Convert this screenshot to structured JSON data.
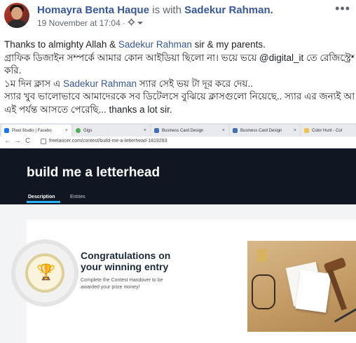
{
  "post": {
    "author": "Homayra Benta Haque",
    "with_text": " is with ",
    "tagged": "Sadekur Rahman.",
    "date": "19 November at 17:04",
    "separator": "·",
    "privacy_icon": "gear-icon",
    "more_label": "•••",
    "body": {
      "line1_a": "Thanks to almighty Allah & ",
      "line1_mention": "Sadekur Rahman",
      "line1_b": " sir & my parents.",
      "line2": "গ্রাফিক ডিজাইন সম্পর্কে আমার কোন আইডিয়া ছিলো না। ভয়ে ভয়ে @digital_it তে রেজিস্ট্রেশন",
      "line3": "করি.",
      "line4_a": "১ম দিন ক্লাস এ ",
      "line4_mention": "Sadekur Rahman",
      "line4_b": " স্যার সেই ভয় টা দূর করে দেয়..",
      "line5": "স্যার খুব ভালোভাবে আমাদেরকে সব ডিটেলসে বুঝিয়ে ক্লাসগুলো নিয়েছে.. স্যার এর জন্যই আমি",
      "line6": "এই পর্যন্ত আসতে পেরেছি... thanks a lot sir."
    }
  },
  "screenshot": {
    "tabs": [
      {
        "label": "Pixel Studio | Facebo",
        "color": "#1877f2"
      },
      {
        "label": "Gigs",
        "color": "#4caf50"
      },
      {
        "label": "Business Card Design",
        "color": "#3f6fb5"
      },
      {
        "label": "Business Card Design",
        "color": "#3f6fb5"
      },
      {
        "label": "Color Hunt - Col",
        "color": "#f2c14e"
      }
    ],
    "tab_close": "×",
    "url": "freelancer.com/contest/build-me-a-letterhead-1819283",
    "nav": {
      "back": "←",
      "forward": "→",
      "reload": "C"
    },
    "page_title": "build me a letterhead",
    "page_tabs": [
      "Description",
      "Entries"
    ],
    "congrats_title": "Congratulations on your winning entry",
    "congrats_sub": "Complete the Contest Handover to be awarded your prize money!",
    "trophy_glyph": "🏆"
  }
}
